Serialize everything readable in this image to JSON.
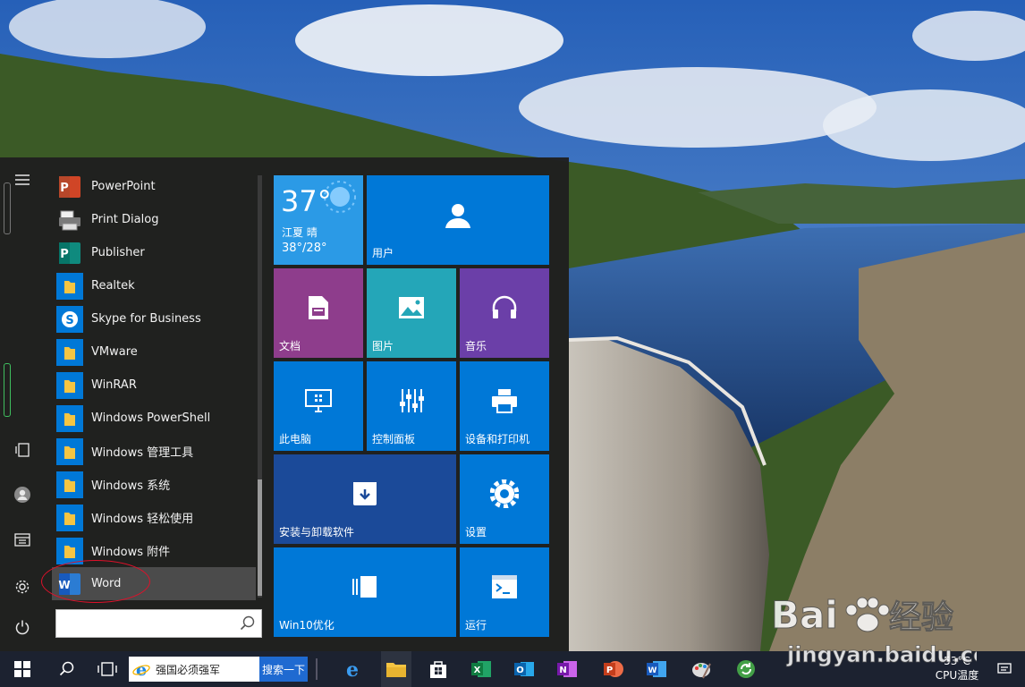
{
  "colors": {
    "tile_blue": "#0078d7",
    "tile_purple": "#8e3d8c",
    "tile_teal": "#24a6b8",
    "tile_violet": "#6b3fa8",
    "tile_navy": "#1b4a99",
    "annotation_red": "#e0102a"
  },
  "start_menu": {
    "apps": [
      {
        "label": "PowerPoint",
        "icon": "powerpoint-icon"
      },
      {
        "label": "Print Dialog",
        "icon": "printer-icon"
      },
      {
        "label": "Publisher",
        "icon": "publisher-icon"
      },
      {
        "label": "Realtek",
        "icon": "folder-icon"
      },
      {
        "label": "Skype for Business",
        "icon": "skype-icon"
      },
      {
        "label": "VMware",
        "icon": "folder-icon"
      },
      {
        "label": "WinRAR",
        "icon": "folder-icon"
      },
      {
        "label": "Windows PowerShell",
        "icon": "folder-icon"
      },
      {
        "label": "Windows 管理工具",
        "icon": "folder-icon"
      },
      {
        "label": "Windows 系统",
        "icon": "folder-icon"
      },
      {
        "label": "Windows 轻松使用",
        "icon": "folder-icon"
      },
      {
        "label": "Windows 附件",
        "icon": "folder-icon"
      },
      {
        "label": "Word",
        "icon": "word-icon"
      }
    ],
    "search_placeholder": "",
    "tiles": {
      "weather": {
        "temp": "37°",
        "location": "江夏 晴",
        "range": "38°/28°"
      },
      "user": "用户",
      "documents": "文档",
      "pictures": "图片",
      "music": "音乐",
      "this_pc": "此电脑",
      "control_panel": "控制面板",
      "devices_printers": "设备和打印机",
      "install_uninstall": "安装与卸载软件",
      "settings": "设置",
      "win10_optimize": "Win10优化",
      "run": "运行"
    }
  },
  "taskbar": {
    "ie_search_text": "强国必须强军",
    "ie_search_button": "搜索一下",
    "tray_temp": "53°C",
    "tray_label": "CPU温度"
  }
}
